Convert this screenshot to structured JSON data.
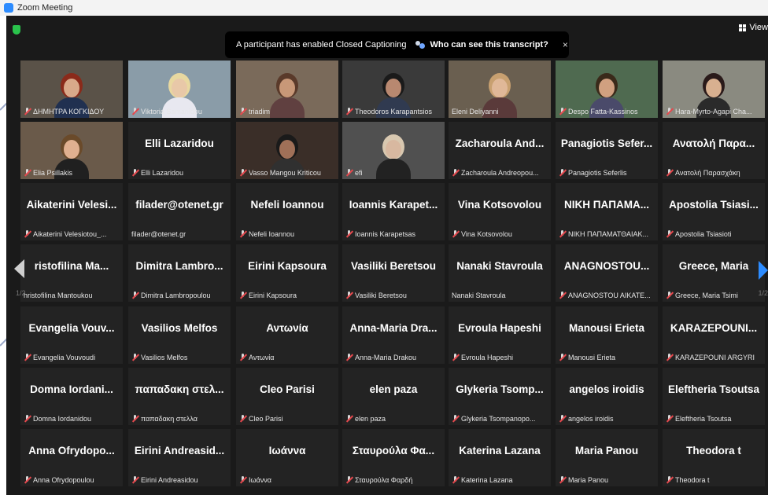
{
  "window": {
    "title": "Zoom Meeting"
  },
  "toolbar": {
    "view_label": "View"
  },
  "banner": {
    "text": "A participant has enabled Closed Captioning",
    "link": "Who can see this transcript?",
    "close": "×"
  },
  "pagination": {
    "left": "1/2",
    "right": "1/2"
  },
  "tiles": [
    {
      "id": "t0",
      "name": "",
      "label": "ΔΗΜΗΤΡΑ ΚΟΓΚΙΔΟΥ",
      "muted": true,
      "video": true
    },
    {
      "id": "t1",
      "name": "",
      "label": "Viktoria Samanidou",
      "muted": true,
      "video": true
    },
    {
      "id": "t2",
      "name": "",
      "label": "triadim",
      "muted": true,
      "video": true
    },
    {
      "id": "t3",
      "name": "",
      "label": "Theodoros Karapantsios",
      "muted": true,
      "video": true
    },
    {
      "id": "t4",
      "name": "",
      "label": "Eleni Deliyanni",
      "muted": false,
      "video": true,
      "active": true
    },
    {
      "id": "t5",
      "name": "",
      "label": "Despo Fatta-Kassinos",
      "muted": true,
      "video": true
    },
    {
      "id": "t6",
      "name": "",
      "label": "Hara-Myrto-Agapi Cha...",
      "muted": true,
      "video": true
    },
    {
      "id": "t7",
      "name": "",
      "label": "Elia Psillakis",
      "muted": true,
      "video": true
    },
    {
      "id": "t8",
      "name": "Elli Lazaridou",
      "label": "Elli Lazaridou",
      "muted": true
    },
    {
      "id": "t9",
      "name": "",
      "label": "Vasso Mangou Kriticou",
      "muted": true,
      "video": true
    },
    {
      "id": "t10",
      "name": "",
      "label": "efi",
      "muted": true,
      "video": true
    },
    {
      "id": "t11",
      "name": "Zacharoula And...",
      "label": "Zacharoula Andreopou...",
      "muted": true
    },
    {
      "id": "t12",
      "name": "Panagiotis Sefer...",
      "label": "Panagiotis Seferlis",
      "muted": true
    },
    {
      "id": "t13",
      "name": "Ανατολή Παρα...",
      "label": "Ανατολή Παρασχάκη",
      "muted": true
    },
    {
      "id": "t14",
      "name": "Aikaterini Velesi...",
      "label": "Aikaterini Velesiotou_...",
      "muted": true
    },
    {
      "id": "t15",
      "name": "filader@otenet.gr",
      "label": "filader@otenet.gr",
      "muted": false
    },
    {
      "id": "t16",
      "name": "Nefeli Ioannou",
      "label": "Nefeli Ioannou",
      "muted": true
    },
    {
      "id": "t17",
      "name": "Ioannis Karapet...",
      "label": "Ioannis Karapetsas",
      "muted": true
    },
    {
      "id": "t18",
      "name": "Vina Kotsovolou",
      "label": "Vina Kotsovolou",
      "muted": true
    },
    {
      "id": "t19",
      "name": "ΝΙΚΗ ΠΑΠΑΜΑ...",
      "label": "ΝΙΚΗ ΠΑΠΑΜΑΤΘΑΙΑΚ...",
      "muted": true
    },
    {
      "id": "t20",
      "name": "Apostolia Tsiasi...",
      "label": "Apostolia Tsiasioti",
      "muted": true
    },
    {
      "id": "t21",
      "name": "ristofilina Ma...",
      "label": "hristofilina Mantoukou",
      "muted": false
    },
    {
      "id": "t22",
      "name": "Dimitra Lambro...",
      "label": "Dimitra Lambropoulou",
      "muted": true
    },
    {
      "id": "t23",
      "name": "Eirini Kapsoura",
      "label": "Eirini Kapsoura",
      "muted": true
    },
    {
      "id": "t24",
      "name": "Vasiliki Beretsou",
      "label": "Vasiliki Beretsou",
      "muted": true
    },
    {
      "id": "t25",
      "name": "Nanaki Stavroula",
      "label": "Nanaki Stavroula",
      "muted": false
    },
    {
      "id": "t26",
      "name": "ANAGNOSTOU...",
      "label": "ANAGNOSTOU AIKATE...",
      "muted": true
    },
    {
      "id": "t27",
      "name": "Greece, Maria",
      "label": "Greece, Maria Tsimi",
      "muted": true
    },
    {
      "id": "t28",
      "name": "Evangelia Vouv...",
      "label": "Evangelia Vouvoudi",
      "muted": true
    },
    {
      "id": "t29",
      "name": "Vasilios Melfos",
      "label": "Vasilios Melfos",
      "muted": true
    },
    {
      "id": "t30",
      "name": "Αντωνία",
      "label": "Αντωνία",
      "muted": true
    },
    {
      "id": "t31",
      "name": "Anna-Maria Dra...",
      "label": "Anna-Maria Drakou",
      "muted": true
    },
    {
      "id": "t32",
      "name": "Evroula Hapeshi",
      "label": "Evroula Hapeshi",
      "muted": true
    },
    {
      "id": "t33",
      "name": "Manousi Erieta",
      "label": "Manousi Erieta",
      "muted": true
    },
    {
      "id": "t34",
      "name": "KARAZEPOUNI...",
      "label": "KARAZEPOUNI ARGYRI",
      "muted": true
    },
    {
      "id": "t35",
      "name": "Domna Iordani...",
      "label": "Domna Iordanidou",
      "muted": true
    },
    {
      "id": "t36",
      "name": "παπαδακη στελ...",
      "label": "παπαδακη στελλα",
      "muted": true
    },
    {
      "id": "t37",
      "name": "Cleo Parisi",
      "label": "Cleo Parisi",
      "muted": true
    },
    {
      "id": "t38",
      "name": "elen paza",
      "label": "elen paza",
      "muted": true
    },
    {
      "id": "t39",
      "name": "Glykeria Tsomp...",
      "label": "Glykeria Tsompanopo...",
      "muted": true
    },
    {
      "id": "t40",
      "name": "angelos iroidis",
      "label": "angelos iroidis",
      "muted": true
    },
    {
      "id": "t41",
      "name": "Eleftheria Tsoutsa",
      "label": "Eleftheria Tsoutsa",
      "muted": true
    },
    {
      "id": "t42",
      "name": "Anna Ofrydopo...",
      "label": "Anna Ofrydopoulou",
      "muted": true
    },
    {
      "id": "t43",
      "name": "Eirini Andreasid...",
      "label": "Eirini Andreasidou",
      "muted": true
    },
    {
      "id": "t44",
      "name": "Ιωάννα",
      "label": "Ιωάννα",
      "muted": true
    },
    {
      "id": "t45",
      "name": "Σταυρούλα Φα...",
      "label": "Σταυρούλα Φαρδή",
      "muted": true
    },
    {
      "id": "t46",
      "name": "Katerina Lazana",
      "label": "Katerina Lazana",
      "muted": true
    },
    {
      "id": "t47",
      "name": "Maria Panou",
      "label": "Maria Panou",
      "muted": true
    },
    {
      "id": "t48",
      "name": "Theodora t",
      "label": "Theodora t",
      "muted": true
    }
  ]
}
